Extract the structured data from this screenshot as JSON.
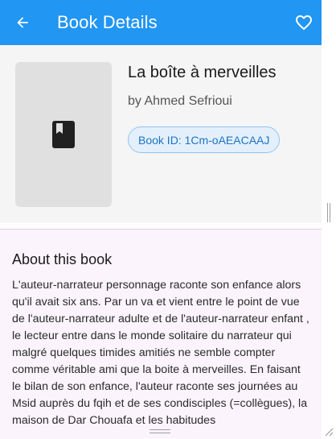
{
  "app_bar": {
    "title": "Book Details",
    "back_icon": "arrow-left-icon",
    "favorite_icon": "heart-outline-icon",
    "color": "#2196f3"
  },
  "book": {
    "cover_icon": "book-icon",
    "title": "La boîte à merveilles",
    "author": "by Ahmed Sefrioui",
    "id_chip": "Book ID: 1Cm-oAEACAAJ"
  },
  "about": {
    "heading": "About this book",
    "description": "L'auteur-narrateur personnage raconte son enfance alors qu'il avait six ans. Par un va et vient entre le point de vue de l'auteur-narrateur adulte et de l'auteur-narrateur enfant , le lecteur entre dans le monde solitaire du narrateur qui malgré quelques timides amitiés ne semble compter comme véritable ami que la boite à merveilles. En faisant le bilan de son enfance, l'auteur raconte ses journées au Msid auprès du fqih et de ses condisciples (=collègues), la maison de Dar Chouafa et les habitudes"
  },
  "colors": {
    "accent": "#2196f3",
    "chip_text": "#1e72c4",
    "content_bg": "#fbf4fc"
  }
}
